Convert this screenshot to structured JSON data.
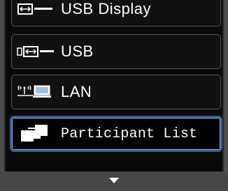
{
  "menu": {
    "items": [
      {
        "label": "USB Display",
        "icon": "usb-display-icon"
      },
      {
        "label": "USB",
        "icon": "usb-icon"
      },
      {
        "label": "LAN",
        "icon": "lan-wireless-icon"
      },
      {
        "label": "Participant List",
        "icon": "participant-list-icon",
        "selected": true
      }
    ]
  },
  "colors": {
    "selection_border": "#2f5f99",
    "panel_background": "#0a0a0a",
    "text": "#ffffff"
  }
}
